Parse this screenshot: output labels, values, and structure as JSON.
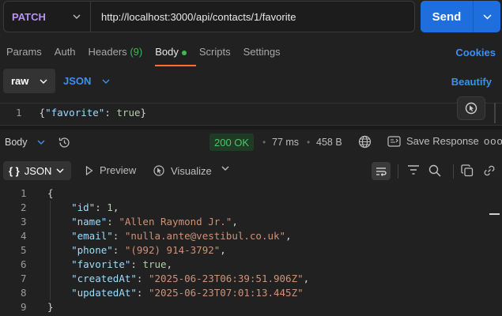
{
  "request": {
    "method": "PATCH",
    "url": "http://localhost:3000/api/contacts/1/favorite",
    "send_label": "Send"
  },
  "tabs": {
    "params": "Params",
    "auth": "Auth",
    "headers": "Headers",
    "headers_count": "(9)",
    "body": "Body",
    "scripts": "Scripts",
    "settings": "Settings",
    "cookies": "Cookies"
  },
  "body_mode": {
    "raw": "raw",
    "format": "JSON",
    "beautify": "Beautify"
  },
  "request_body": {
    "line_number": "1",
    "text": "{\"favorite\": true}"
  },
  "response": {
    "body_label": "Body",
    "status": "200 OK",
    "time": "77 ms",
    "size": "458 B",
    "save_label": "Save Response",
    "more": "ooo",
    "view_format": "JSON",
    "preview": "Preview",
    "visualize": "Visualize"
  },
  "response_lines": [
    {
      "n": "1",
      "parts": [
        [
          "p",
          "{"
        ]
      ]
    },
    {
      "n": "2",
      "parts": [
        [
          "p",
          "    "
        ],
        [
          "k",
          "\"id\""
        ],
        [
          "p",
          ": "
        ],
        [
          "v",
          "1"
        ],
        [
          "p",
          ","
        ]
      ]
    },
    {
      "n": "3",
      "parts": [
        [
          "p",
          "    "
        ],
        [
          "k",
          "\"name\""
        ],
        [
          "p",
          ": "
        ],
        [
          "s",
          "\"Allen Raymond Jr.\""
        ],
        [
          "p",
          ","
        ]
      ]
    },
    {
      "n": "4",
      "parts": [
        [
          "p",
          "    "
        ],
        [
          "k",
          "\"email\""
        ],
        [
          "p",
          ": "
        ],
        [
          "s",
          "\"nulla.ante@vestibul.co.uk\""
        ],
        [
          "p",
          ","
        ]
      ]
    },
    {
      "n": "5",
      "parts": [
        [
          "p",
          "    "
        ],
        [
          "k",
          "\"phone\""
        ],
        [
          "p",
          ": "
        ],
        [
          "s",
          "\"(992) 914-3792\""
        ],
        [
          "p",
          ","
        ]
      ]
    },
    {
      "n": "6",
      "parts": [
        [
          "p",
          "    "
        ],
        [
          "k",
          "\"favorite\""
        ],
        [
          "p",
          ": "
        ],
        [
          "v",
          "true"
        ],
        [
          "p",
          ","
        ]
      ]
    },
    {
      "n": "7",
      "parts": [
        [
          "p",
          "    "
        ],
        [
          "k",
          "\"createdAt\""
        ],
        [
          "p",
          ": "
        ],
        [
          "s",
          "\"2025-06-23T06:39:51.906Z\""
        ],
        [
          "p",
          ","
        ]
      ]
    },
    {
      "n": "8",
      "parts": [
        [
          "p",
          "    "
        ],
        [
          "k",
          "\"updatedAt\""
        ],
        [
          "p",
          ": "
        ],
        [
          "s",
          "\"2025-06-23T07:01:13.445Z\""
        ]
      ]
    },
    {
      "n": "9",
      "parts": [
        [
          "p",
          "}"
        ]
      ]
    }
  ],
  "colors": {
    "accent": "#ff6c37",
    "send": "#1e6fdd",
    "link": "#3d8ff2",
    "status_ok": "#4ec26c",
    "method": "#b793f0"
  }
}
